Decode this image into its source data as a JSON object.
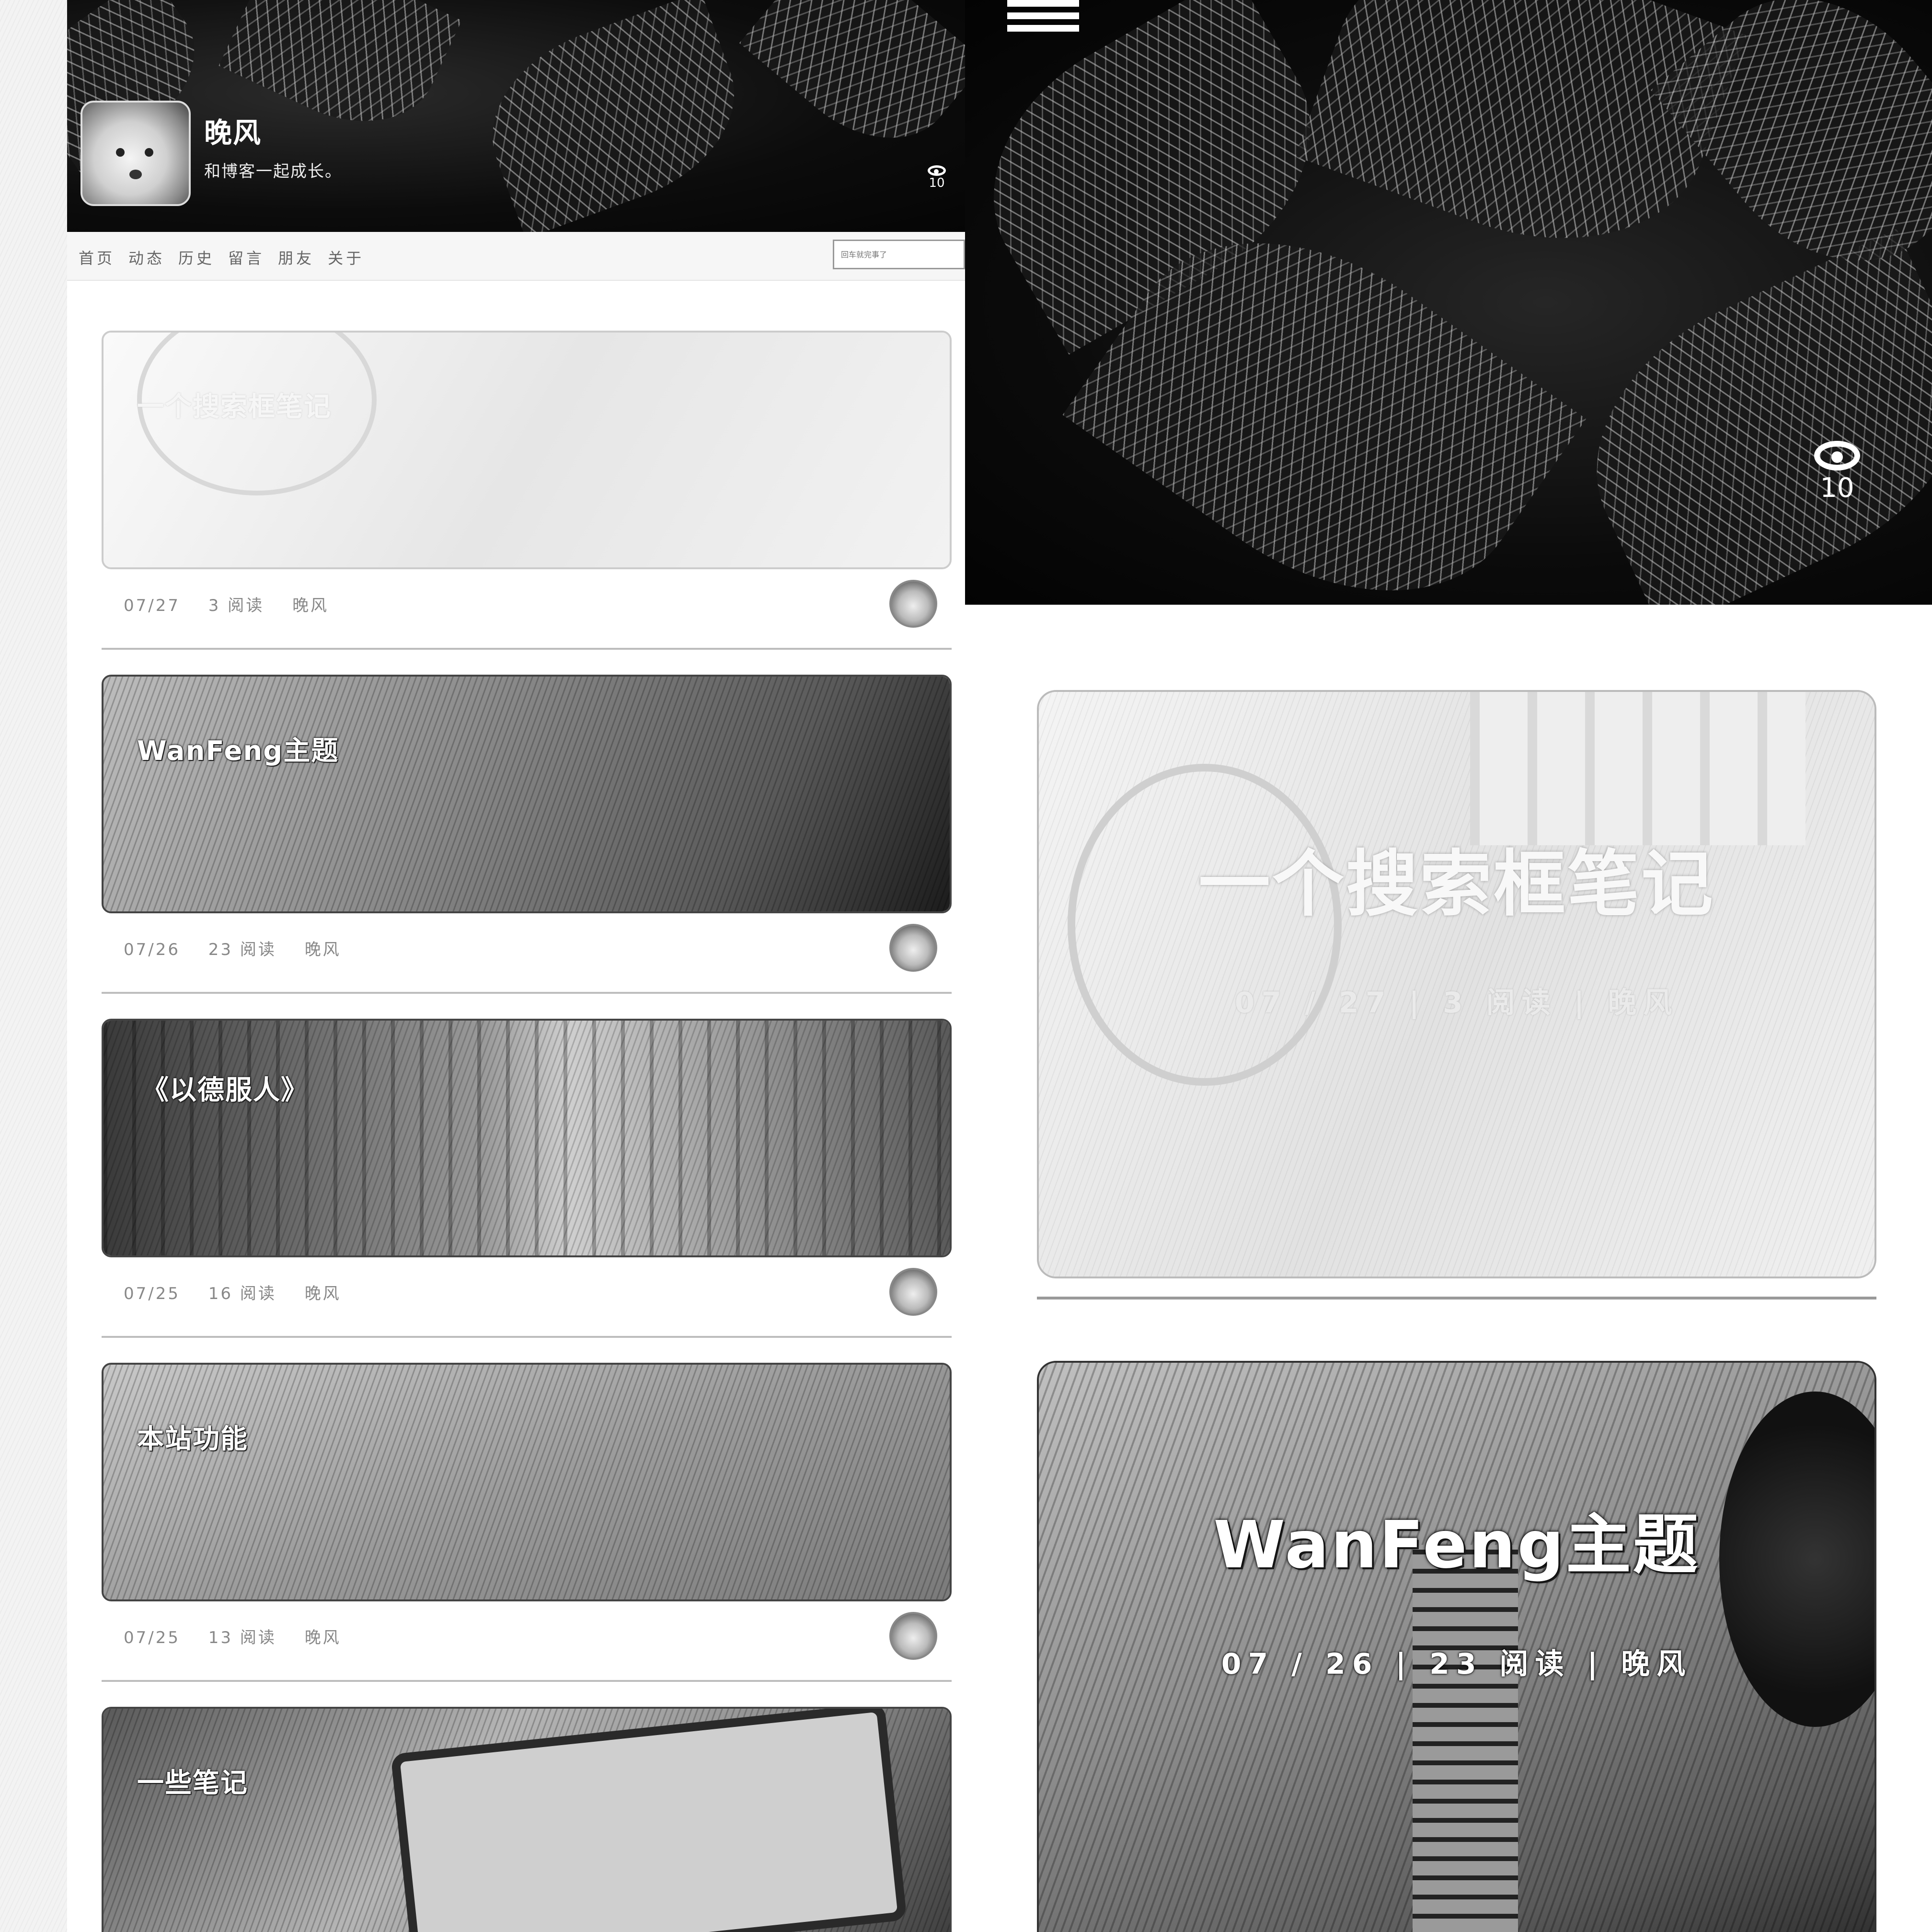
{
  "site": {
    "name": "晚风",
    "description": "和博客一起成长。",
    "views": "10"
  },
  "nav": {
    "items": [
      "首页",
      "动态",
      "历史",
      "留言",
      "朋友",
      "关于"
    ],
    "search_placeholder": "回车就完事了"
  },
  "posts": [
    {
      "title": "一个搜索框笔记",
      "excerpt": "",
      "date": "07/27",
      "reads": "3 阅读",
      "author": "晚风",
      "big_meta": "07 / 27  | 3 阅读  | 晚风"
    },
    {
      "title": "WanFeng主题",
      "excerpt": "",
      "date": "07/26",
      "reads": "23 阅读",
      "author": "晚风",
      "big_meta": "07 / 26  | 23 阅读  | 晚风"
    },
    {
      "title": "《以德服人》",
      "excerpt": "",
      "date": "07/25",
      "reads": "16 阅读",
      "author": "晚风"
    },
    {
      "title": "本站功能",
      "excerpt": "",
      "date": "07/25",
      "reads": "13 阅读",
      "author": "晚风"
    },
    {
      "title": "一些笔记",
      "excerpt": ""
    }
  ],
  "colors": {
    "hero_dark": "#0b0b0b",
    "page_bg": "#f3f3f3",
    "meta_text": "#888888"
  }
}
